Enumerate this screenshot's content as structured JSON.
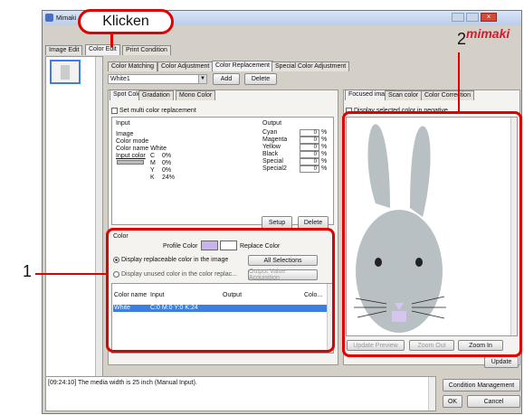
{
  "window": {
    "title": "Mimaki",
    "logo": "mimaki"
  },
  "main_tabs": [
    "Image Edit",
    "Color Edit",
    "Print Condition"
  ],
  "sub_tabs": [
    "Color Matching",
    "Color Adjustment",
    "Color Replacement",
    "Special Color Adjustment"
  ],
  "toolbar": {
    "select_value": "White1",
    "add": "Add",
    "delete": "Delete"
  },
  "left_tabs": [
    "Spot Color",
    "Gradation",
    "Mono Color"
  ],
  "multi_replace": "Set multi color replacement",
  "input": {
    "heading": "Input",
    "image": "Image",
    "color_mode": "Color mode",
    "color_name": "Color name White",
    "input_color": "Input color",
    "c": "C",
    "m": "M",
    "y": "Y",
    "k": "K",
    "cv": "0%",
    "mv": "0%",
    "yv": "0%",
    "kv": "24%"
  },
  "output": {
    "heading": "Output",
    "rows": [
      {
        "label": "Cyan",
        "value": "0",
        "unit": "%"
      },
      {
        "label": "Magenta",
        "value": "0",
        "unit": "%"
      },
      {
        "label": "Yellow",
        "value": "0",
        "unit": "%"
      },
      {
        "label": "Black",
        "value": "0",
        "unit": "%"
      },
      {
        "label": "Special",
        "value": "0",
        "unit": "%"
      },
      {
        "label": "Special2",
        "value": "0",
        "unit": "%"
      }
    ],
    "setup": "Setup",
    "delete": "Delete"
  },
  "color_section": {
    "heading": "Color",
    "profile_color": "Profile Color",
    "replace_color": "Replace Color",
    "profile_hex": "#c8b4ec",
    "replace_hex": "#ffffff",
    "radio1": "Display replaceable color in the image",
    "radio2": "Display unused color in the color replac...",
    "all_selections": "All Selections",
    "output_value": "Output Value Acquisition",
    "table_headers": [
      "Color name",
      "Input",
      "Output",
      "Colo..."
    ],
    "row": {
      "name": "White",
      "input": "C:0 M:0 Y:0 K:24"
    }
  },
  "right_tabs": [
    "Focused image",
    "Scan color",
    "Color Correction"
  ],
  "display_negative": "Display selected color in negative",
  "preview_buttons": {
    "update_preview": "Update Preview",
    "zoom_out": "Zoom Out",
    "zoom_in": "Zoom In"
  },
  "update": "Update",
  "log": "[09:24:10] The media width is 25 inch (Manual Input).",
  "footer": {
    "condition_management": "Condition Management",
    "ok": "OK",
    "cancel": "Cancel"
  },
  "annotations": {
    "klicken": "Klicken",
    "one": "1",
    "two": "2"
  },
  "colors": {
    "accent_red": "#e00000",
    "select_blue": "#3d7fe0",
    "bunny": "#b8c0c3"
  }
}
